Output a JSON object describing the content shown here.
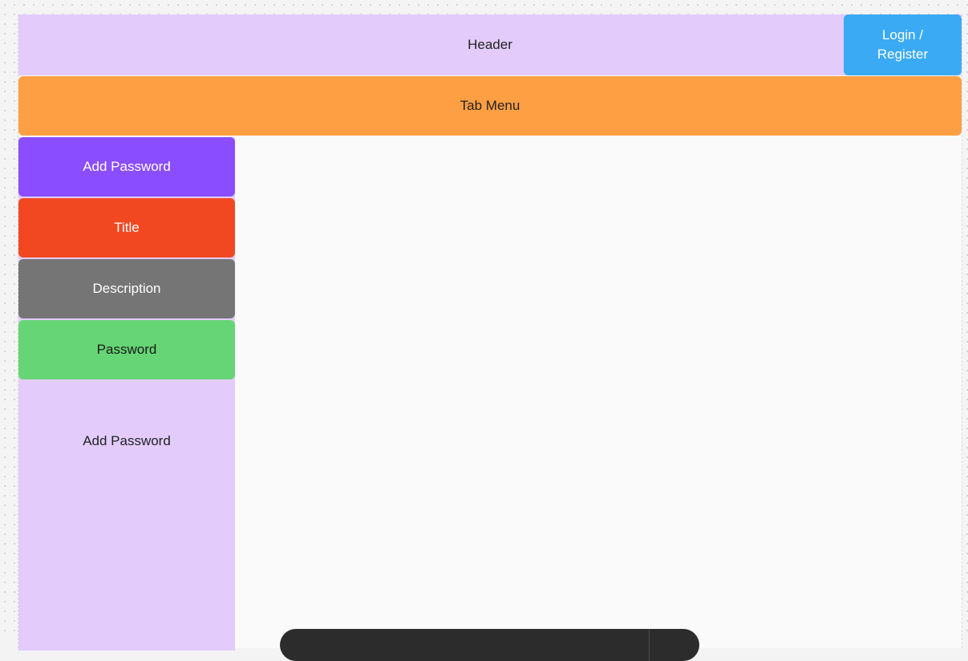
{
  "header": {
    "title": "Header",
    "login_label": "Login /\nRegister"
  },
  "tab_menu": {
    "label": "Tab Menu"
  },
  "sidebar": {
    "items": [
      {
        "label": "Add Password",
        "color": "#8a4dff"
      },
      {
        "label": "Title",
        "color": "#f24822"
      },
      {
        "label": "Description",
        "color": "#757575"
      },
      {
        "label": "Password",
        "color": "#66d575"
      }
    ],
    "footer_label": "Add Password"
  },
  "colors": {
    "header_bg": "#e3ccfc",
    "login_bg": "#3aaaf5",
    "tab_menu_bg": "#ff9f43",
    "toolbar_bg": "#2c2c2c"
  }
}
